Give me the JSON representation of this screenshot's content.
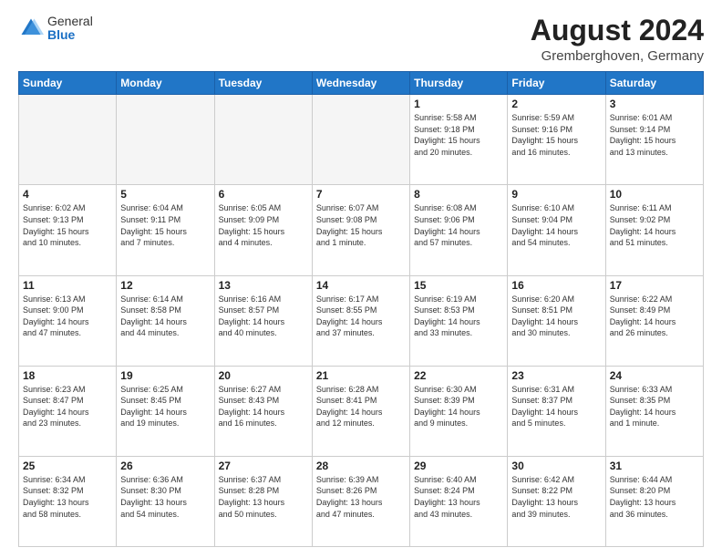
{
  "logo": {
    "general": "General",
    "blue": "Blue"
  },
  "header": {
    "month": "August 2024",
    "location": "Gremberghoven, Germany"
  },
  "weekdays": [
    "Sunday",
    "Monday",
    "Tuesday",
    "Wednesday",
    "Thursday",
    "Friday",
    "Saturday"
  ],
  "weeks": [
    [
      {
        "day": "",
        "info": ""
      },
      {
        "day": "",
        "info": ""
      },
      {
        "day": "",
        "info": ""
      },
      {
        "day": "",
        "info": ""
      },
      {
        "day": "1",
        "info": "Sunrise: 5:58 AM\nSunset: 9:18 PM\nDaylight: 15 hours\nand 20 minutes."
      },
      {
        "day": "2",
        "info": "Sunrise: 5:59 AM\nSunset: 9:16 PM\nDaylight: 15 hours\nand 16 minutes."
      },
      {
        "day": "3",
        "info": "Sunrise: 6:01 AM\nSunset: 9:14 PM\nDaylight: 15 hours\nand 13 minutes."
      }
    ],
    [
      {
        "day": "4",
        "info": "Sunrise: 6:02 AM\nSunset: 9:13 PM\nDaylight: 15 hours\nand 10 minutes."
      },
      {
        "day": "5",
        "info": "Sunrise: 6:04 AM\nSunset: 9:11 PM\nDaylight: 15 hours\nand 7 minutes."
      },
      {
        "day": "6",
        "info": "Sunrise: 6:05 AM\nSunset: 9:09 PM\nDaylight: 15 hours\nand 4 minutes."
      },
      {
        "day": "7",
        "info": "Sunrise: 6:07 AM\nSunset: 9:08 PM\nDaylight: 15 hours\nand 1 minute."
      },
      {
        "day": "8",
        "info": "Sunrise: 6:08 AM\nSunset: 9:06 PM\nDaylight: 14 hours\nand 57 minutes."
      },
      {
        "day": "9",
        "info": "Sunrise: 6:10 AM\nSunset: 9:04 PM\nDaylight: 14 hours\nand 54 minutes."
      },
      {
        "day": "10",
        "info": "Sunrise: 6:11 AM\nSunset: 9:02 PM\nDaylight: 14 hours\nand 51 minutes."
      }
    ],
    [
      {
        "day": "11",
        "info": "Sunrise: 6:13 AM\nSunset: 9:00 PM\nDaylight: 14 hours\nand 47 minutes."
      },
      {
        "day": "12",
        "info": "Sunrise: 6:14 AM\nSunset: 8:58 PM\nDaylight: 14 hours\nand 44 minutes."
      },
      {
        "day": "13",
        "info": "Sunrise: 6:16 AM\nSunset: 8:57 PM\nDaylight: 14 hours\nand 40 minutes."
      },
      {
        "day": "14",
        "info": "Sunrise: 6:17 AM\nSunset: 8:55 PM\nDaylight: 14 hours\nand 37 minutes."
      },
      {
        "day": "15",
        "info": "Sunrise: 6:19 AM\nSunset: 8:53 PM\nDaylight: 14 hours\nand 33 minutes."
      },
      {
        "day": "16",
        "info": "Sunrise: 6:20 AM\nSunset: 8:51 PM\nDaylight: 14 hours\nand 30 minutes."
      },
      {
        "day": "17",
        "info": "Sunrise: 6:22 AM\nSunset: 8:49 PM\nDaylight: 14 hours\nand 26 minutes."
      }
    ],
    [
      {
        "day": "18",
        "info": "Sunrise: 6:23 AM\nSunset: 8:47 PM\nDaylight: 14 hours\nand 23 minutes."
      },
      {
        "day": "19",
        "info": "Sunrise: 6:25 AM\nSunset: 8:45 PM\nDaylight: 14 hours\nand 19 minutes."
      },
      {
        "day": "20",
        "info": "Sunrise: 6:27 AM\nSunset: 8:43 PM\nDaylight: 14 hours\nand 16 minutes."
      },
      {
        "day": "21",
        "info": "Sunrise: 6:28 AM\nSunset: 8:41 PM\nDaylight: 14 hours\nand 12 minutes."
      },
      {
        "day": "22",
        "info": "Sunrise: 6:30 AM\nSunset: 8:39 PM\nDaylight: 14 hours\nand 9 minutes."
      },
      {
        "day": "23",
        "info": "Sunrise: 6:31 AM\nSunset: 8:37 PM\nDaylight: 14 hours\nand 5 minutes."
      },
      {
        "day": "24",
        "info": "Sunrise: 6:33 AM\nSunset: 8:35 PM\nDaylight: 14 hours\nand 1 minute."
      }
    ],
    [
      {
        "day": "25",
        "info": "Sunrise: 6:34 AM\nSunset: 8:32 PM\nDaylight: 13 hours\nand 58 minutes."
      },
      {
        "day": "26",
        "info": "Sunrise: 6:36 AM\nSunset: 8:30 PM\nDaylight: 13 hours\nand 54 minutes."
      },
      {
        "day": "27",
        "info": "Sunrise: 6:37 AM\nSunset: 8:28 PM\nDaylight: 13 hours\nand 50 minutes."
      },
      {
        "day": "28",
        "info": "Sunrise: 6:39 AM\nSunset: 8:26 PM\nDaylight: 13 hours\nand 47 minutes."
      },
      {
        "day": "29",
        "info": "Sunrise: 6:40 AM\nSunset: 8:24 PM\nDaylight: 13 hours\nand 43 minutes."
      },
      {
        "day": "30",
        "info": "Sunrise: 6:42 AM\nSunset: 8:22 PM\nDaylight: 13 hours\nand 39 minutes."
      },
      {
        "day": "31",
        "info": "Sunrise: 6:44 AM\nSunset: 8:20 PM\nDaylight: 13 hours\nand 36 minutes."
      }
    ]
  ]
}
